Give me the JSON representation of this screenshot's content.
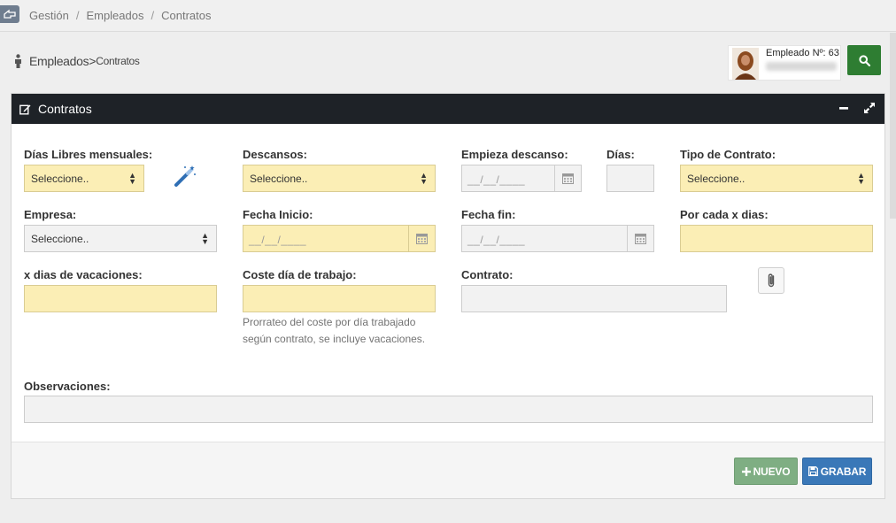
{
  "breadcrumb": [
    "Gestión",
    "Empleados",
    "Contratos"
  ],
  "page_title": {
    "main": "Empleados",
    "sep": ">",
    "sub": "Contratos"
  },
  "employee": {
    "label": "Empleado Nº: 63"
  },
  "panel": {
    "title": "Contratos"
  },
  "form": {
    "dias_libres": {
      "label": "Días Libres mensuales:",
      "value": "Seleccione.."
    },
    "descansos": {
      "label": "Descansos:",
      "value": "Seleccione.."
    },
    "empieza_descanso": {
      "label": "Empieza descanso:",
      "placeholder": "__/__/____"
    },
    "dias": {
      "label": "Días:",
      "value": ""
    },
    "tipo_contrato": {
      "label": "Tipo de Contrato:",
      "value": "Seleccione.."
    },
    "empresa": {
      "label": "Empresa:",
      "value": "Seleccione.."
    },
    "fecha_inicio": {
      "label": "Fecha Inicio:",
      "placeholder": "__/__/____"
    },
    "fecha_fin": {
      "label": "Fecha fin:",
      "placeholder": "__/__/____"
    },
    "por_cada": {
      "label": "Por cada x dias:",
      "value": ""
    },
    "dias_vacaciones": {
      "label": "x dias de vacaciones:",
      "value": ""
    },
    "coste_dia": {
      "label": "Coste día de trabajo:",
      "value": "",
      "help": "Prorrateo del coste por día trabajado según contrato, se incluye vacaciones."
    },
    "contrato": {
      "label": "Contrato:",
      "value": ""
    },
    "observaciones": {
      "label": "Observaciones:",
      "value": ""
    }
  },
  "buttons": {
    "nuevo": "NUEVO",
    "grabar": "GRABAR"
  },
  "icons": {
    "home": "hand-pointer-icon",
    "person": "person-icon",
    "search": "search-icon",
    "edit": "edit-icon",
    "minimize": "minus-icon",
    "expand": "expand-icon",
    "wand": "magic-wand-icon",
    "calendar": "calendar-icon",
    "attach": "paperclip-icon",
    "plus": "plus-icon",
    "save": "save-icon"
  },
  "colors": {
    "required_field": "#fbeeb5",
    "panel_header": "#1e2227",
    "search_button": "#2e7d32",
    "nuevo_button": "#7fae83",
    "grabar_button": "#3a78b8"
  }
}
